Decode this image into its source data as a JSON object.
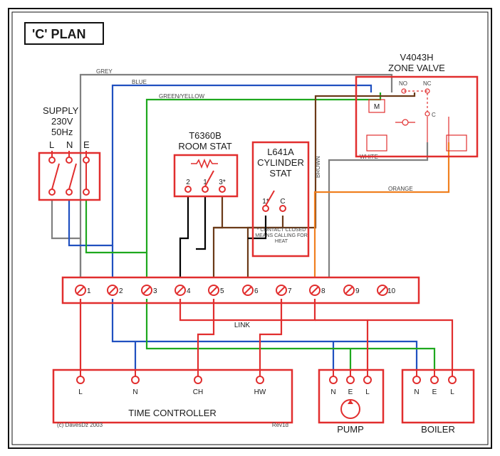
{
  "title": "'C' PLAN",
  "supply": {
    "label1": "SUPPLY",
    "label2": "230V",
    "label3": "50Hz",
    "L": "L",
    "N": "N",
    "E": "E"
  },
  "roomStat": {
    "label1": "T6360B",
    "label2": "ROOM STAT",
    "t1": "1",
    "t2": "2",
    "t3": "3*"
  },
  "cylStat": {
    "label1": "L641A",
    "label2": "CYLINDER",
    "label3": "STAT",
    "t1": "1*",
    "tC": "C",
    "note": "* CONTACT CLOSED MEANS CALLING FOR HEAT"
  },
  "zoneValve": {
    "label1": "V4043H",
    "label2": "ZONE VALVE",
    "M": "M",
    "NO": "NO",
    "NC": "NC",
    "C": "C"
  },
  "terminalStrip": {
    "labels": [
      "1",
      "2",
      "3",
      "4",
      "5",
      "6",
      "7",
      "8",
      "9",
      "10"
    ],
    "link": "LINK"
  },
  "timeController": {
    "label": "TIME CONTROLLER",
    "L": "L",
    "N": "N",
    "CH": "CH",
    "HW": "HW"
  },
  "pump": {
    "label": "PUMP",
    "N": "N",
    "E": "E",
    "L": "L"
  },
  "boiler": {
    "label": "BOILER",
    "N": "N",
    "E": "E",
    "L": "L"
  },
  "wireLabels": {
    "grey": "GREY",
    "blue": "BLUE",
    "greenYellow": "GREEN/YELLOW",
    "brown": "BROWN",
    "white": "WHITE",
    "orange": "ORANGE"
  },
  "meta": {
    "copyright": "(c) DavesDz 2003",
    "rev": "Rev1d"
  },
  "colors": {
    "red": "#E12E2E",
    "grey": "#808080",
    "blue": "#2050C0",
    "green": "#1EA81E",
    "brown": "#6B3A18",
    "orange": "#F08020",
    "black": "#000000"
  }
}
